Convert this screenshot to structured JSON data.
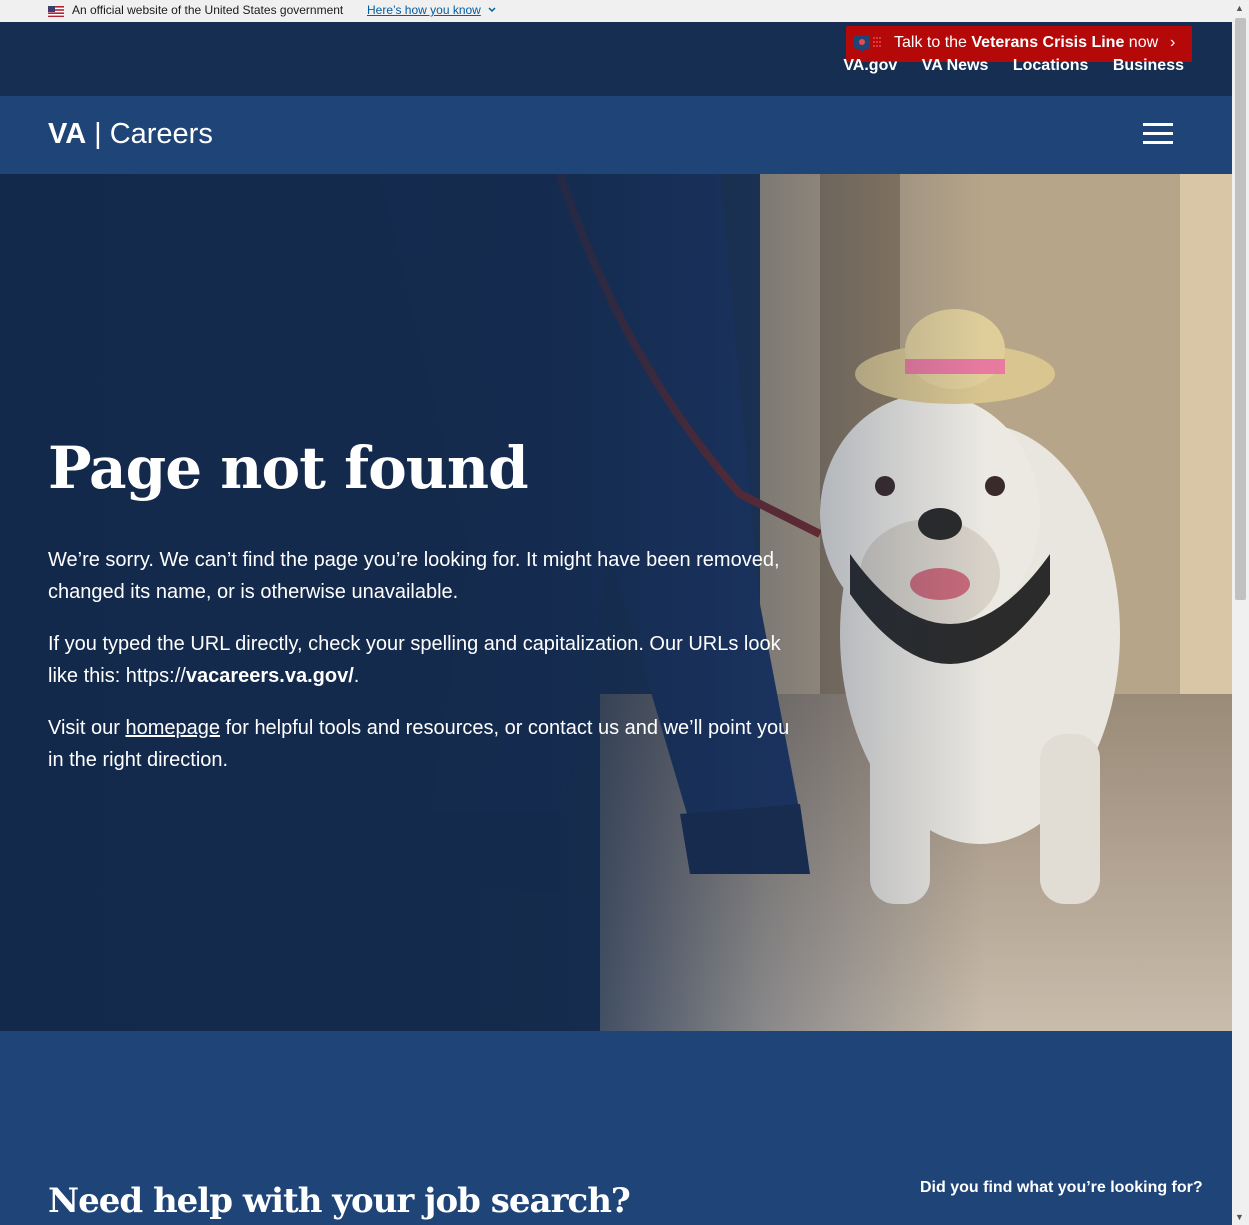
{
  "gov_banner": {
    "text": "An official website of the United States government",
    "link": "Here’s how you know"
  },
  "crisis_line": {
    "prefix": "Talk to the ",
    "bold": "Veterans Crisis Line",
    "suffix": " now",
    "arrow": "›"
  },
  "top_nav": [
    "VA.gov",
    "VA News",
    "Locations",
    "Business"
  ],
  "logo": {
    "va": "VA",
    "sep": "|",
    "name": "Careers"
  },
  "hero": {
    "title": "Page not found",
    "p1": "We’re sorry. We can’t find the page you’re looking for. It might have been removed, changed its name, or is otherwise unavailable.",
    "p2_pre": "If you typed the URL directly, check your spelling and capitalization. Our URLs look like this: https://",
    "p2_bold": "vacareers.va.gov/",
    "p2_post": ".",
    "p3_pre": "Visit our ",
    "p3_link": "homepage",
    "p3_post": " for helpful tools and resources, or contact us and we’ll point you in the right direction."
  },
  "help": {
    "title": "Need help with your job search?",
    "feedback": "Did you find what you’re looking for?"
  },
  "colors": {
    "navy": "#162e51",
    "blue": "#1f4478",
    "crisis_red": "#b50909"
  }
}
